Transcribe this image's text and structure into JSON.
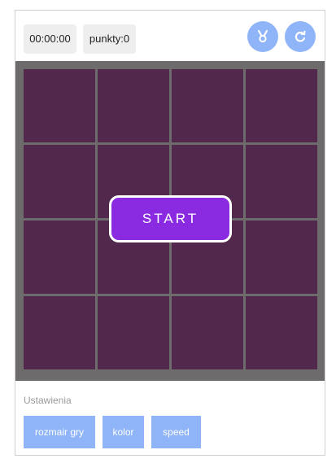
{
  "topbar": {
    "timer": "00:00:00",
    "score": "punkty:0",
    "medal_icon": "medal-icon",
    "refresh_icon": "refresh-icon"
  },
  "board": {
    "rows": 4,
    "cols": 4,
    "cell_color": "#52294d",
    "grid_color": "#6e6b6c",
    "start_label": "START",
    "start_color": "#8a2be2"
  },
  "settings": {
    "title": "Ustawienia",
    "buttons": [
      "rozmair gry",
      "kolor",
      "speed"
    ]
  },
  "colors": {
    "accent": "#8fb5f8"
  }
}
